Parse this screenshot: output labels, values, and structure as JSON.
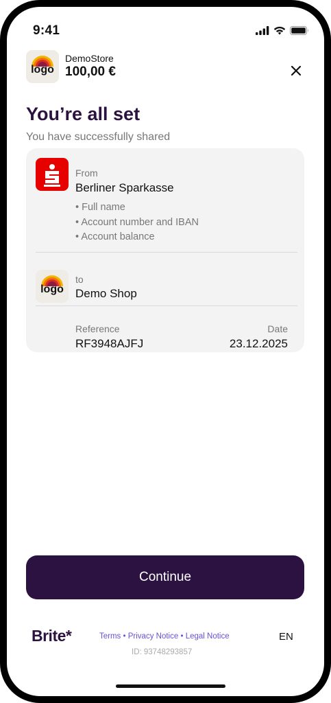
{
  "status_bar": {
    "time": "9:41"
  },
  "merchant": {
    "name": "DemoStore",
    "amount": "100,00 €",
    "logo_text": "logo"
  },
  "header": {
    "title": "You’re all set",
    "subtitle": "You have successfully shared"
  },
  "card": {
    "from_label": "From",
    "bank_name": "Berliner Sparkasse",
    "shared_items": [
      "Full name",
      "Account number and IBAN",
      "Account balance"
    ],
    "to_label": "to",
    "shop_name": "Demo Shop",
    "reference_label": "Reference",
    "reference_value": "RF3948AJFJ",
    "date_label": "Date",
    "date_value": "23.12.2025"
  },
  "continue_label": "Continue",
  "footer": {
    "brand": "Brite*",
    "links": [
      "Terms",
      "Privacy Notice",
      "Legal Notice"
    ],
    "language": "EN",
    "id_text": "ID: 93748293857"
  },
  "colors": {
    "primary": "#2b1240",
    "bank_red": "#e60000",
    "link": "#6a4fd8",
    "card_bg": "#f3f3f3"
  },
  "icons": {
    "close": "close-icon",
    "signal": "signal-icon",
    "wifi": "wifi-icon",
    "battery": "battery-icon",
    "bank": "sparkasse-logo-icon"
  }
}
